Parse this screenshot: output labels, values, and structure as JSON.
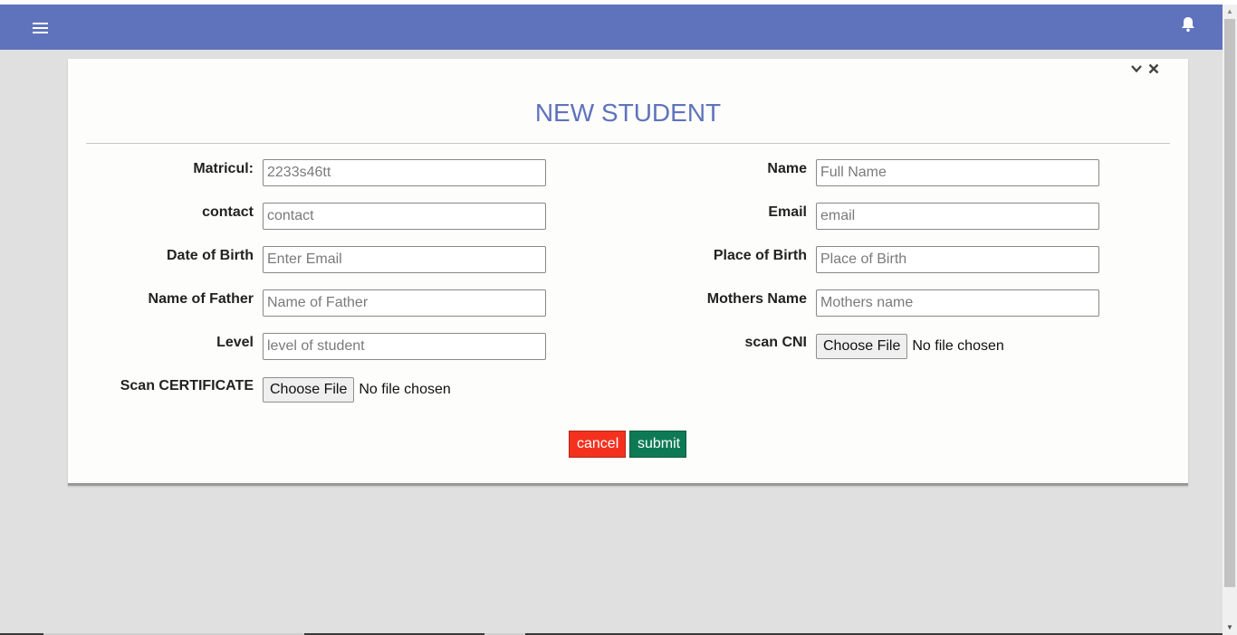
{
  "navbar": {
    "color": "#5f73bd",
    "menu_icon": "hamburger-menu-icon",
    "notification_icon": "bell-icon"
  },
  "card": {
    "collapse_icon": "chevron-down-icon",
    "close_icon": "close-icon",
    "title": "NEW STUDENT"
  },
  "form": {
    "matricul": {
      "label": "Matricul:",
      "placeholder": "2233s46tt"
    },
    "contact": {
      "label": "contact",
      "placeholder": "contact"
    },
    "date_of_birth": {
      "label": "Date of Birth",
      "placeholder": "Enter Email"
    },
    "name_of_father": {
      "label": "Name of Father",
      "placeholder": "Name of Father"
    },
    "level": {
      "label": "Level",
      "placeholder": "level of student"
    },
    "scan_certificate": {
      "label": "Scan CERTIFICATE",
      "button": "Choose File",
      "status": "No file chosen"
    },
    "name": {
      "label": "Name",
      "placeholder": "Full Name"
    },
    "email": {
      "label": "Email",
      "placeholder": "email"
    },
    "place_of_birth": {
      "label": "Place of Birth",
      "placeholder": "Place of Birth"
    },
    "mothers_name": {
      "label": "Mothers Name",
      "placeholder": "Mothers name"
    },
    "scan_cni": {
      "label": "scan CNI",
      "button": "Choose File",
      "status": "No file chosen"
    }
  },
  "actions": {
    "cancel_label": "cancel",
    "cancel_color": "#f4311f",
    "submit_label": "submit",
    "submit_color": "#0e7a55"
  }
}
